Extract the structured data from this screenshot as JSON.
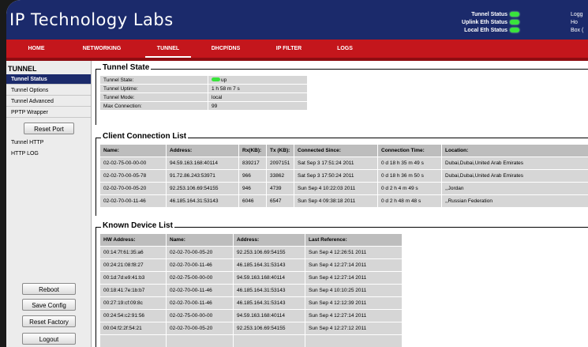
{
  "header": {
    "logo": "IP Technology Labs",
    "status": [
      {
        "label": "Tunnel Status"
      },
      {
        "label": "Uplink Eth Status"
      },
      {
        "label": "Local Eth Status"
      }
    ],
    "right_lines": [
      "Logg",
      "Ho",
      "Box ("
    ],
    "led_color": "#39e33c"
  },
  "nav": {
    "items": [
      "HOME",
      "NETWORKING",
      "TUNNEL",
      "DHCP/DNS",
      "IP FILTER",
      "LOGS"
    ],
    "active": "TUNNEL"
  },
  "sidebar": {
    "title": "TUNNEL",
    "items": [
      "Tunnel Status",
      "Tunnel Options",
      "Tunnel Advanced",
      "PPTP Wrapper"
    ],
    "reset_port": "Reset Port",
    "items2": [
      "Tunnel HTTP",
      "HTTP LOG"
    ],
    "buttons": [
      "Reboot",
      "Save Config",
      "Reset Factory",
      "Logout"
    ]
  },
  "tunnel_state": {
    "title": "Tunnel State",
    "rows": [
      {
        "label": "Tunnel State:",
        "value": "up",
        "led": true
      },
      {
        "label": "Tunnel Uptime:",
        "value": "1 h 58 m 7 s"
      },
      {
        "label": "Tunnel Mode:",
        "value": "local"
      },
      {
        "label": "Max Connection:",
        "value": "99"
      }
    ]
  },
  "client_list": {
    "title": "Client Connection List",
    "headers": [
      "Name:",
      "Address:",
      "Rx(KB):",
      "Tx (KB):",
      "Connected Since:",
      "Connection Time:",
      "Location:"
    ],
    "rows": [
      [
        "02-02-75-00-00-00",
        "94.59.163.168:40114",
        "839217",
        "2097151",
        "Sat Sep 3 17:51:24 2011",
        "0 d 18 h 35 m 49 s",
        "Dubai,Dubai,United Arab Emirates"
      ],
      [
        "02-02-70-00-05-78",
        "91.72.86.243:53971",
        "966",
        "33862",
        "Sat Sep 3 17:50:24 2011",
        "0 d 18 h 36 m 50 s",
        "Dubai,Dubai,United Arab Emirates"
      ],
      [
        "02-02-70-00-05-20",
        "92.253.106.69:54155",
        "946",
        "4739",
        "Sun Sep 4 10:22:03 2011",
        "0 d 2 h 4 m 49 s",
        ",,Jordan"
      ],
      [
        "02-02-70-00-11-46",
        "46.185.164.31:53143",
        "6046",
        "6547",
        "Sun Sep 4 09:38:18 2011",
        "0 d 2 h 48 m 48 s",
        ",,Russian Federation"
      ]
    ]
  },
  "device_list": {
    "title": "Known Device List",
    "headers": [
      "HW Address:",
      "Name:",
      "Address:",
      "Last Reference:"
    ],
    "rows": [
      [
        "00:14:7f:61:35:a6",
        "02-02-70-00-05-20",
        "92.253.106.69:54155",
        "Sun Sep 4 12:26:51 2011"
      ],
      [
        "00:24:21:08:f8:27",
        "02-02-70-00-11-46",
        "46.185.164.31:53143",
        "Sun Sep 4 12:27:14 2011"
      ],
      [
        "00:1d:7d:e9:41:b3",
        "02-02-75-00-00-00",
        "94.59.163.168:40114",
        "Sun Sep 4 12:27:14 2011"
      ],
      [
        "00:18:41:7e:1b:b7",
        "02-02-70-00-11-46",
        "46.185.164.31:53143",
        "Sun Sep 4 10:10:25 2011"
      ],
      [
        "00:27:19:cf:09:8c",
        "02-02-70-00-11-46",
        "46.185.164.31:53143",
        "Sun Sep 4 12:12:39 2011"
      ],
      [
        "00:24:54:c2:91:56",
        "02-02-75-00-00-00",
        "94.59.163.168:40114",
        "Sun Sep 4 12:27:14 2011"
      ],
      [
        "00:04:f2:2f:54:21",
        "02-02-70-00-05-20",
        "92.253.106.69:54155",
        "Sun Sep 4 12:27:12 2011"
      ],
      [
        "",
        "",
        "",
        ""
      ]
    ]
  }
}
